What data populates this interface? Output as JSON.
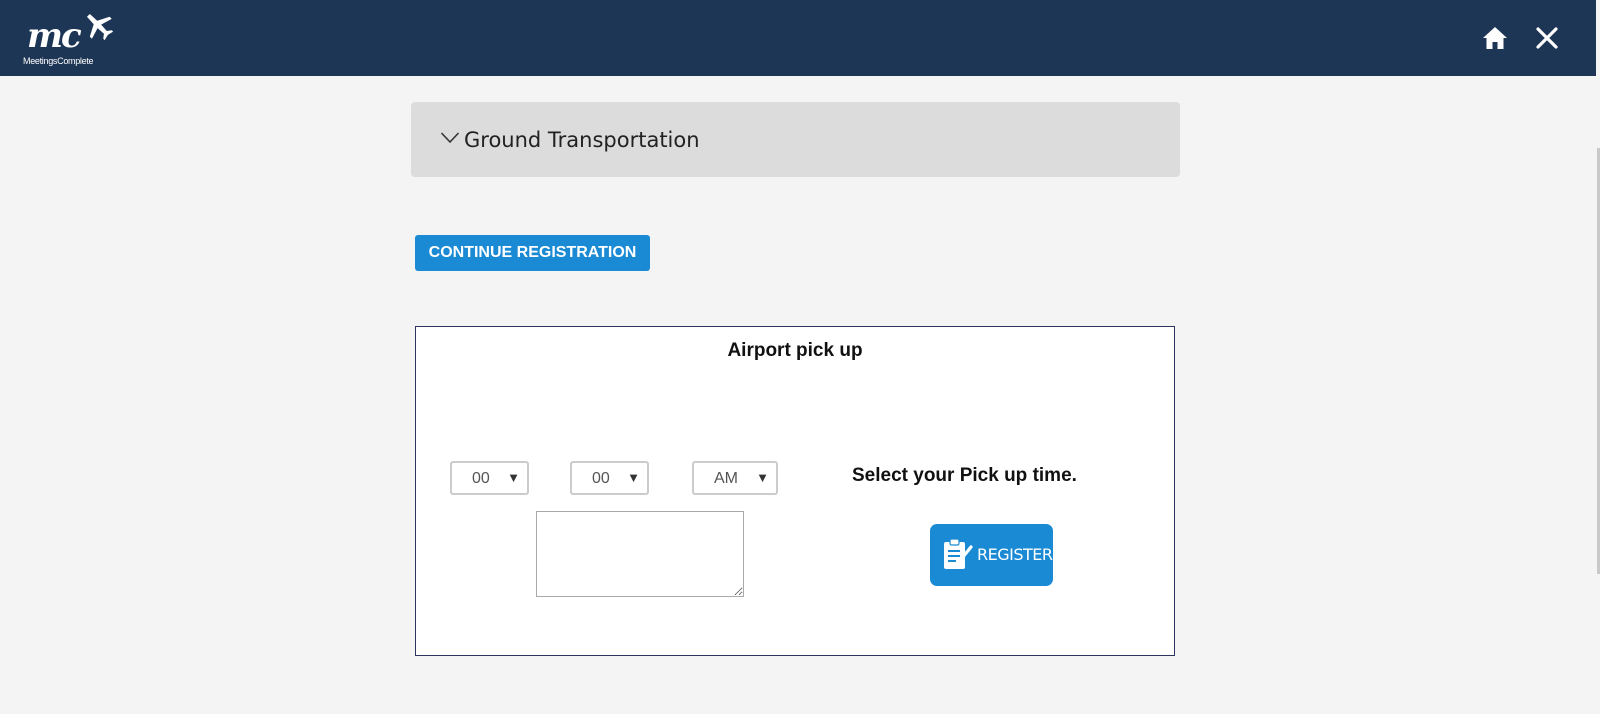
{
  "header": {
    "logo_mark": "mc",
    "logo_subtitle": "MeetingsComplete",
    "background_color": "#1e3655",
    "icons": [
      "plane-icon",
      "home-icon",
      "close-icon"
    ]
  },
  "accordion": {
    "title": "Ground Transportation",
    "icon": "chevron-down-icon"
  },
  "continue_button": {
    "label": "CONTINUE REGISTRATION",
    "color": "#1a8ad4"
  },
  "card": {
    "title": "Airport pick up",
    "hour": {
      "value": "00"
    },
    "minute": {
      "value": "00"
    },
    "ampm": {
      "value": "AM"
    },
    "pickup_label": "Select your Pick up time.",
    "notes": {
      "value": ""
    },
    "register_button": {
      "label": "REGISTER",
      "icon": "clipboard-check-icon",
      "color": "#1a8ad4"
    }
  }
}
